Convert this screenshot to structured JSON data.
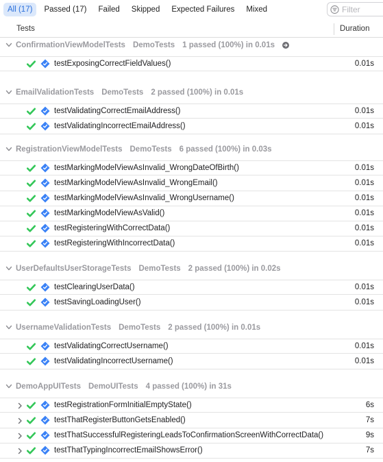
{
  "filter_tabs": [
    {
      "label": "All (17)",
      "active": true
    },
    {
      "label": "Passed (17)",
      "active": false
    },
    {
      "label": "Failed",
      "active": false
    },
    {
      "label": "Skipped",
      "active": false
    },
    {
      "label": "Expected Failures",
      "active": false
    },
    {
      "label": "Mixed",
      "active": false
    }
  ],
  "filter": {
    "placeholder": "Filter",
    "value": ""
  },
  "columns": {
    "tests": "Tests",
    "duration": "Duration"
  },
  "colors": {
    "accent": "#2a6fdb",
    "pass": "#34c759",
    "test_icon": "#3b82f6"
  },
  "groups": [
    {
      "name": "ConfirmationViewModelTests",
      "target": "DemoTests",
      "summary": "1 passed (100%) in 0.01s",
      "jump": true,
      "tests": [
        {
          "name": "testExposingCorrectFieldValues()",
          "duration": "0.01s",
          "expandable": false
        }
      ]
    },
    {
      "name": "EmailValidationTests",
      "target": "DemoTests",
      "summary": "2 passed (100%) in 0.01s",
      "jump": false,
      "tests": [
        {
          "name": "testValidatingCorrectEmailAddress()",
          "duration": "0.01s",
          "expandable": false
        },
        {
          "name": "testValidatingIncorrectEmailAddress()",
          "duration": "0.01s",
          "expandable": false
        }
      ]
    },
    {
      "name": "RegistrationViewModelTests",
      "target": "DemoTests",
      "summary": "6 passed (100%) in 0.03s",
      "jump": false,
      "tests": [
        {
          "name": "testMarkingModelViewAsInvalid_WrongDateOfBirth()",
          "duration": "0.01s",
          "expandable": false
        },
        {
          "name": "testMarkingModelViewAsInvalid_WrongEmail()",
          "duration": "0.01s",
          "expandable": false
        },
        {
          "name": "testMarkingModelViewAsInvalid_WrongUsername()",
          "duration": "0.01s",
          "expandable": false
        },
        {
          "name": "testMarkingModelViewAsValid()",
          "duration": "0.01s",
          "expandable": false
        },
        {
          "name": "testRegisteringWithCorrectData()",
          "duration": "0.01s",
          "expandable": false
        },
        {
          "name": "testRegisteringWithIncorrectData()",
          "duration": "0.01s",
          "expandable": false
        }
      ]
    },
    {
      "name": "UserDefaultsUserStorageTests",
      "target": "DemoTests",
      "summary": "2 passed (100%) in 0.02s",
      "jump": false,
      "tests": [
        {
          "name": "testClearingUserData()",
          "duration": "0.01s",
          "expandable": false
        },
        {
          "name": "testSavingLoadingUser()",
          "duration": "0.01s",
          "expandable": false
        }
      ]
    },
    {
      "name": "UsernameValidationTests",
      "target": "DemoTests",
      "summary": "2 passed (100%) in 0.01s",
      "jump": false,
      "tests": [
        {
          "name": "testValidatingCorrectUsername()",
          "duration": "0.01s",
          "expandable": false
        },
        {
          "name": "testValidatingIncorrectUsername()",
          "duration": "0.01s",
          "expandable": false
        }
      ]
    },
    {
      "name": "DemoAppUITests",
      "target": "DemoUITests",
      "summary": "4 passed (100%) in 31s",
      "jump": false,
      "tests": [
        {
          "name": "testRegistrationFormInitialEmptyState()",
          "duration": "6s",
          "expandable": true
        },
        {
          "name": "testThatRegisterButtonGetsEnabled()",
          "duration": "7s",
          "expandable": true
        },
        {
          "name": "testThatSuccessfulRegisteringLeadsToConfirmationScreenWithCorrectData()",
          "duration": "9s",
          "expandable": true
        },
        {
          "name": "testThatTypingIncorrectEmailShowsError()",
          "duration": "7s",
          "expandable": true
        }
      ]
    }
  ]
}
